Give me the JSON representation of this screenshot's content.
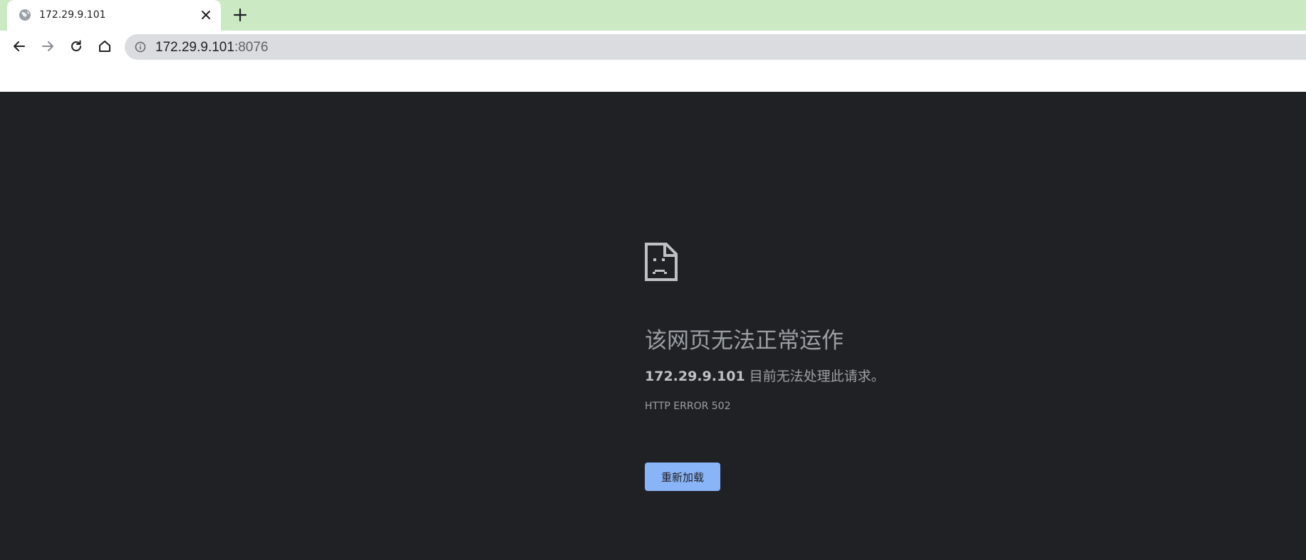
{
  "tab": {
    "title": "172.29.9.101",
    "favicon": "globe-icon",
    "close_icon": "close-icon"
  },
  "new_tab_icon": "plus-icon",
  "toolbar": {
    "back_icon": "arrow-left-icon",
    "forward_icon": "arrow-right-icon",
    "reload_icon": "reload-icon",
    "home_icon": "home-icon"
  },
  "omnibox": {
    "info_icon": "info-icon",
    "host": "172.29.9.101",
    "port": ":8076"
  },
  "error_page": {
    "icon": "sad-page-icon",
    "heading": "该网页无法正常运作",
    "description_host": "172.29.9.101",
    "description_text": " 目前无法处理此请求。",
    "error_code": "HTTP ERROR 502",
    "reload_button_label": "重新加载"
  },
  "colors": {
    "tab_strip_bg": "#cbeac3",
    "page_bg": "#202124",
    "omnibox_bg": "#dadce0",
    "button_bg": "#8ab4f8",
    "text_muted": "#9aa0a6"
  }
}
